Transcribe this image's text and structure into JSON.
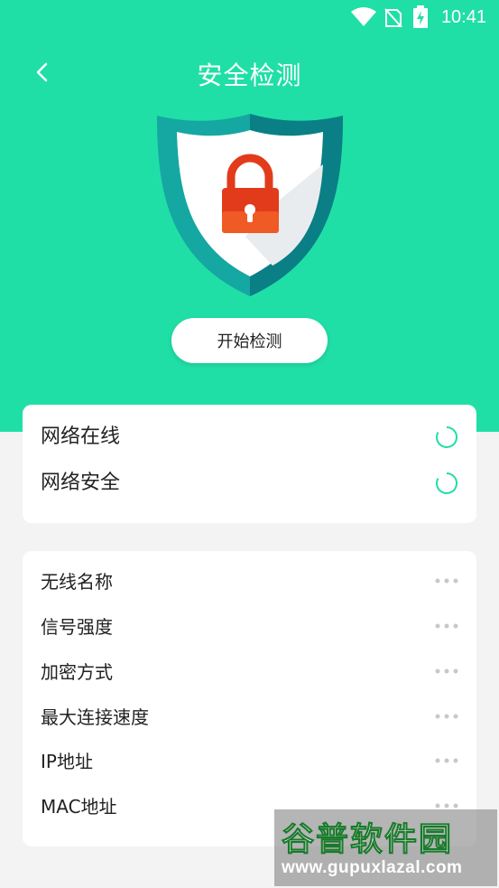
{
  "status_bar": {
    "time": "10:41"
  },
  "header": {
    "title": "安全检测"
  },
  "action": {
    "start_label": "开始检测"
  },
  "status_checks": [
    {
      "label": "网络在线"
    },
    {
      "label": "网络安全"
    }
  ],
  "wifi_info": [
    {
      "label": "无线名称"
    },
    {
      "label": "信号强度"
    },
    {
      "label": "加密方式"
    },
    {
      "label": "最大连接速度"
    },
    {
      "label": "IP地址"
    },
    {
      "label": "MAC地址"
    }
  ],
  "watermark": {
    "name": "谷普软件园",
    "url": "www.gupuxlazal.com"
  },
  "colors": {
    "accent": "#20dfa6",
    "lock": "#e23b1c",
    "shield_dark": "#0a7f86"
  },
  "icons": [
    "wifi-icon",
    "no-sim-icon",
    "battery-charging-icon",
    "back-arrow-icon",
    "shield-lock-icon",
    "spinner-icon",
    "more-dots-icon"
  ]
}
